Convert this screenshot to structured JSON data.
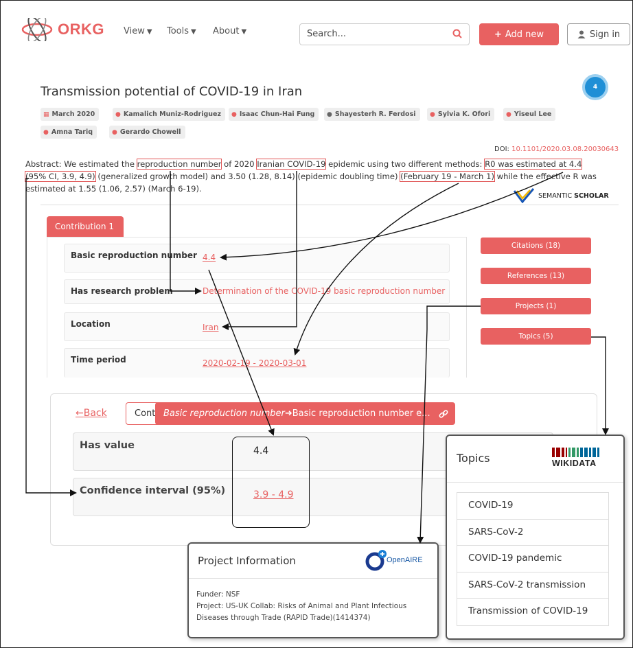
{
  "navbar": {
    "logo_text": "ORKG",
    "menu": [
      {
        "label": "View"
      },
      {
        "label": "Tools"
      },
      {
        "label": "About"
      }
    ],
    "search_placeholder": "Search...",
    "add_new_label": "Add new",
    "sign_in_label": "Sign in"
  },
  "paper": {
    "title": "Transmission potential of COVID-19 in Iran",
    "stat_count": "4",
    "date": "March 2020",
    "authors": [
      "Kamalich Muniz-Rodriguez",
      "Isaac Chun-Hai Fung",
      "Shayesterh R. Ferdosi",
      "Sylvia K. Ofori",
      "Yiseul Lee",
      "Amna Tariq",
      "Gerardo Chowell"
    ],
    "doi_label": "DOI:",
    "doi": "10.1101/2020.03.08.20030643",
    "abstract": {
      "a1": "Abstract: We estimated the ",
      "h1": "reproduction number",
      "a2": " of 2020 ",
      "h2": "Iranian COVID-19",
      "a3": " epidemic using two different methods: ",
      "h3": "R0 was estimated at 4.4",
      "h4": "(95% CI, 3.9, 4.9)",
      "a4": " (generalized growth model) and 3.50 (1.28, 8.14) (epidemic doubling time) ",
      "h5": "(February 19 - March 1)",
      "a5": " while the effective R was estimated at 1.55 (1.06, 2.57) (March 6-19)."
    },
    "semantic_scholar": {
      "left": "SEMANTIC",
      "right": "SCHOLAR"
    }
  },
  "contribution": {
    "tab_label": "Contribution 1",
    "rows": [
      {
        "key": "Basic reproduction number",
        "value": "4.4"
      },
      {
        "key": "Has research problem",
        "value": "Determination of the COVID-19 basic reproduction number"
      },
      {
        "key": "Location",
        "value": "Iran"
      },
      {
        "key": "Time period",
        "value": "2020-02-19 - 2020-03-01"
      }
    ],
    "side_buttons": [
      "Citations (18)",
      "References (13)",
      "Projects (1)",
      "Topics (5)"
    ]
  },
  "statement": {
    "back_label": "Back",
    "cont_label": "Cont",
    "bar_italic": "Basic reproduction number",
    "bar_rest": " Basic reproduction number e...",
    "has_value_key": "Has value",
    "has_value": "4.4",
    "ci_key": "Confidence interval (95%)",
    "ci_value": "3.9 - 4.9"
  },
  "topics": {
    "title": "Topics",
    "brand": "WIKIDATA",
    "items": [
      "COVID-19",
      "SARS-CoV-2",
      "COVID-19 pandemic",
      "SARS-CoV-2 transmission",
      "Transmission of COVID-19"
    ]
  },
  "project": {
    "title": "Project Information",
    "brand": "OpenAIRE",
    "funder": "Funder: NSF",
    "project": "Project: US-UK Collab: Risks of Animal and Plant Infectious Diseases through Trade (RAPID Trade)(1414374)"
  },
  "colors": {
    "accent": "#e86161",
    "stat_blue": "#1f8fd6"
  }
}
